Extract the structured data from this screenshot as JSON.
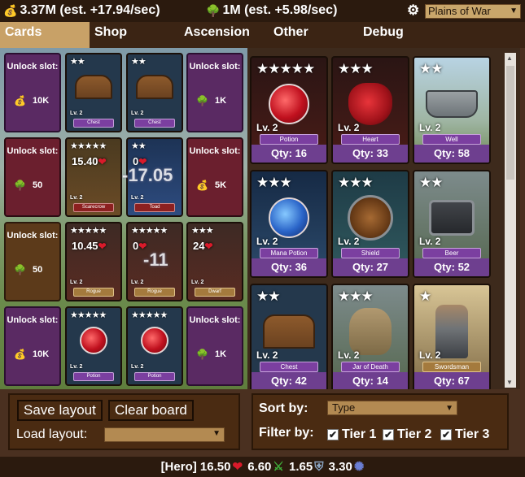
{
  "resources": {
    "gold": "3.37M (est. +17.94/sec)",
    "wood": "1M (est. +5.98/sec)",
    "gold_icon": "coin-bag-icon",
    "wood_icon": "tree-icon"
  },
  "zone": {
    "selected": "Plains of War"
  },
  "tabs": [
    {
      "label": "Cards",
      "active": true
    },
    {
      "label": "Shop",
      "active": false
    },
    {
      "label": "Ascension",
      "active": false
    },
    {
      "label": "Other",
      "active": false
    },
    {
      "label": "Debug",
      "active": false
    }
  ],
  "board": {
    "unlock_text": "Unlock slot:",
    "slots": [
      {
        "cost": "10K",
        "icon": "coin-bag-icon"
      },
      {
        "cost": "1K",
        "icon": "tree-icon"
      },
      {
        "cost": "50",
        "icon": "tree-icon"
      },
      {
        "cost": "5K",
        "icon": "coin-bag-icon"
      },
      {
        "cost": "50",
        "icon": "tree-icon"
      },
      {
        "cost": "10K",
        "icon": "coin-bag-icon"
      },
      {
        "cost": "1K",
        "icon": "tree-icon"
      }
    ],
    "cards": [
      {
        "stars": "★★",
        "level": "Lv. 2",
        "name": "Chest"
      },
      {
        "stars": "★★",
        "level": "Lv. 2",
        "name": "Chest"
      },
      {
        "stars": "★★★★★",
        "level": "Lv. 2",
        "name": "Scarecrow",
        "hp": "15.40"
      },
      {
        "stars": "★★",
        "level": "Lv. 2",
        "name": "Toad",
        "hp": "0"
      },
      {
        "stars": "★★★★★",
        "level": "Lv. 2",
        "name": "Rogue",
        "hp": "10.45"
      },
      {
        "stars": "★★★★★",
        "level": "Lv. 2",
        "name": "Rogue",
        "hp": "0"
      },
      {
        "stars": "★★★",
        "level": "Lv. 2",
        "name": "Dwarf",
        "hp": "24"
      },
      {
        "stars": "★★★★★",
        "level": "Lv. 2",
        "name": "Potion"
      },
      {
        "stars": "★★★★★",
        "level": "Lv. 2",
        "name": "Potion"
      }
    ],
    "floating": [
      "-17.05",
      "-11"
    ]
  },
  "collection": [
    {
      "stars": "★★★★★",
      "level": "Lv. 2",
      "name": "Potion",
      "qty": "Qty: 16"
    },
    {
      "stars": "★★★",
      "level": "Lv. 2",
      "name": "Heart",
      "qty": "Qty: 33"
    },
    {
      "stars": "★★",
      "level": "Lv. 2",
      "name": "Well",
      "qty": "Qty: 58"
    },
    {
      "stars": "★★★",
      "level": "Lv. 2",
      "name": "Mana Potion",
      "qty": "Qty: 36"
    },
    {
      "stars": "★★★",
      "level": "Lv. 2",
      "name": "Shield",
      "qty": "Qty: 27"
    },
    {
      "stars": "★★",
      "level": "Lv. 2",
      "name": "Beer",
      "qty": "Qty: 52"
    },
    {
      "stars": "★★",
      "level": "Lv. 2",
      "name": "Chest",
      "qty": "Qty: 42"
    },
    {
      "stars": "★★★",
      "level": "Lv. 2",
      "name": "Jar of Death",
      "qty": "Qty: 14"
    },
    {
      "stars": "★",
      "level": "Lv. 2",
      "name": "Swordsman",
      "qty": "Qty: 67"
    }
  ],
  "layout": {
    "save": "Save layout",
    "clear": "Clear board",
    "load_label": "Load layout:"
  },
  "sort": {
    "label": "Sort by:",
    "selected": "Type",
    "filter_label": "Filter by:",
    "filters": [
      {
        "label": "Tier 1",
        "checked": true
      },
      {
        "label": "Tier 2",
        "checked": true
      },
      {
        "label": "Tier 3",
        "checked": true
      }
    ]
  },
  "hero": {
    "label": "[Hero] 16.50",
    "atk": "6.60",
    "def": "1.65",
    "spd": "3.30"
  }
}
